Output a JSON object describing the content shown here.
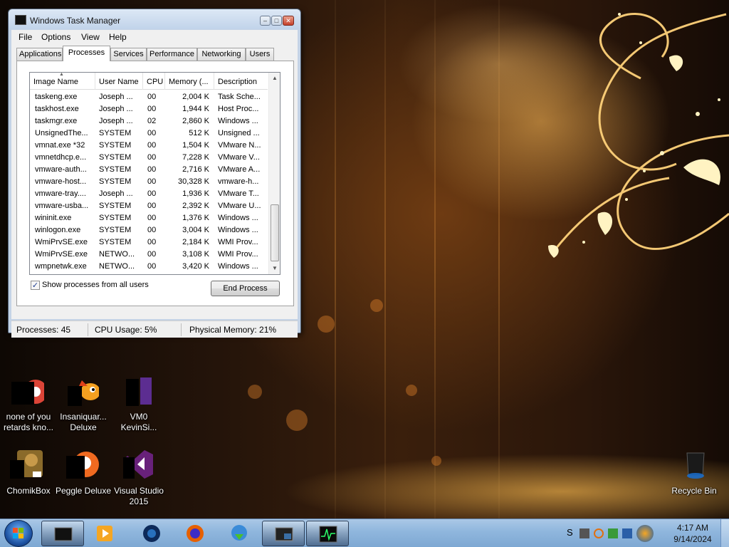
{
  "window": {
    "title": "Windows Task Manager",
    "menu": [
      "File",
      "Options",
      "View",
      "Help"
    ],
    "tabs": [
      "Applications",
      "Processes",
      "Services",
      "Performance",
      "Networking",
      "Users"
    ],
    "active_tab": "Processes",
    "columns": [
      "Image Name",
      "User Name",
      "CPU",
      "Memory (...",
      "Description"
    ],
    "processes": [
      {
        "name": "taskeng.exe",
        "user": "Joseph ...",
        "cpu": "00",
        "mem": "2,004 K",
        "desc": "Task Sche..."
      },
      {
        "name": "taskhost.exe",
        "user": "Joseph ...",
        "cpu": "00",
        "mem": "1,944 K",
        "desc": "Host Proc..."
      },
      {
        "name": "taskmgr.exe",
        "user": "Joseph ...",
        "cpu": "02",
        "mem": "2,860 K",
        "desc": "Windows ..."
      },
      {
        "name": "UnsignedThe...",
        "user": "SYSTEM",
        "cpu": "00",
        "mem": "512 K",
        "desc": "Unsigned ..."
      },
      {
        "name": "vmnat.exe *32",
        "user": "SYSTEM",
        "cpu": "00",
        "mem": "1,504 K",
        "desc": "VMware N..."
      },
      {
        "name": "vmnetdhcp.e...",
        "user": "SYSTEM",
        "cpu": "00",
        "mem": "7,228 K",
        "desc": "VMware V..."
      },
      {
        "name": "vmware-auth...",
        "user": "SYSTEM",
        "cpu": "00",
        "mem": "2,716 K",
        "desc": "VMware A..."
      },
      {
        "name": "vmware-host...",
        "user": "SYSTEM",
        "cpu": "00",
        "mem": "30,328 K",
        "desc": "vmware-h..."
      },
      {
        "name": "vmware-tray....",
        "user": "Joseph ...",
        "cpu": "00",
        "mem": "1,936 K",
        "desc": "VMware T..."
      },
      {
        "name": "vmware-usba...",
        "user": "SYSTEM",
        "cpu": "00",
        "mem": "2,392 K",
        "desc": "VMware U..."
      },
      {
        "name": "wininit.exe",
        "user": "SYSTEM",
        "cpu": "00",
        "mem": "1,376 K",
        "desc": "Windows ..."
      },
      {
        "name": "winlogon.exe",
        "user": "SYSTEM",
        "cpu": "00",
        "mem": "3,004 K",
        "desc": "Windows ..."
      },
      {
        "name": "WmiPrvSE.exe",
        "user": "SYSTEM",
        "cpu": "00",
        "mem": "2,184 K",
        "desc": "WMI Prov..."
      },
      {
        "name": "WmiPrvSE.exe",
        "user": "NETWO...",
        "cpu": "00",
        "mem": "3,108 K",
        "desc": "WMI Prov..."
      },
      {
        "name": "wmpnetwk.exe",
        "user": "NETWO...",
        "cpu": "00",
        "mem": "3,420 K",
        "desc": "Windows ..."
      }
    ],
    "show_all_label": "Show processes from all users",
    "show_all_checked": true,
    "end_process_label": "End Process",
    "status": {
      "processes": "Processes: 45",
      "cpu": "CPU Usage: 5%",
      "memory": "Physical Memory: 21%"
    }
  },
  "desktop_icons": [
    {
      "label": "none of you\nretards kno...",
      "icon": "chrome-icon"
    },
    {
      "label": "Insaniquar...\nDeluxe",
      "icon": "fish-game-icon"
    },
    {
      "label": "VM0\nKevinSi...",
      "icon": "visual-studio-file-icon"
    },
    {
      "label": "ChomikBox",
      "icon": "chomikbox-icon"
    },
    {
      "label": "Peggle Deluxe",
      "icon": "peggle-icon"
    },
    {
      "label": "Visual Studio\n2015",
      "icon": "visual-studio-icon"
    },
    {
      "label": "Recycle Bin",
      "icon": "recycle-bin-icon"
    }
  ],
  "taskbar": {
    "items": [
      "task-manager-icon",
      "media-player-icon",
      "cyberlink-icon",
      "firefox-icon",
      "internet-download-manager-icon",
      "window-icon",
      "resource-monitor-icon"
    ],
    "clock_time": "4:17 AM",
    "clock_date": "9/14/2024",
    "tray_letter": "S"
  }
}
